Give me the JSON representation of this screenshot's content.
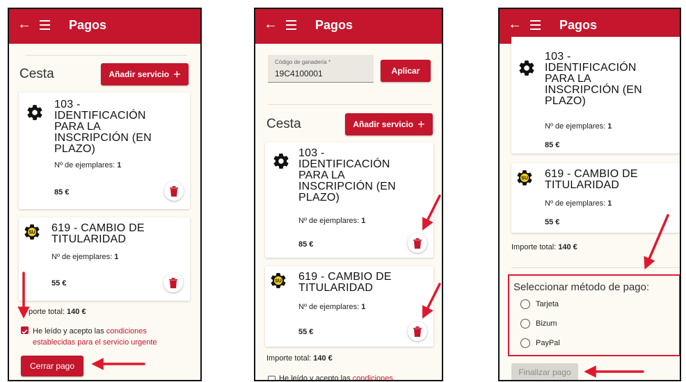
{
  "app": {
    "title": "Pagos"
  },
  "cart": {
    "heading": "Cesta",
    "add_service_label": "Añadir servicio",
    "items": [
      {
        "title_lines": [
          "103 -",
          "IDENTIFICACIÓN",
          "PARA LA",
          "INSCRIPCIÓN (EN",
          "PLAZO)"
        ],
        "qty_label": "Nº de ejemplares:",
        "qty": "1",
        "price": "85 €",
        "icon": "gear-icon"
      },
      {
        "title_lines": [
          "619 - CAMBIO DE",
          "TITULARIDAD"
        ],
        "qty_label": "Nº de ejemplares:",
        "qty": "1",
        "price": "55 €",
        "icon": "urgent-gear-icon",
        "badge": "SU"
      }
    ],
    "total_label": "Importe total:",
    "total_value": "140 €"
  },
  "screen1": {
    "total_partial_label": "porte total:",
    "terms_prefix": "He leído y acepto las",
    "terms_link_line1": "condiciones",
    "terms_link_line2": "establecidas para el servicio urgente",
    "terms_checked": true,
    "close_button": "Cerrar pago"
  },
  "screen2": {
    "code_label": "Código de ganadería *",
    "code_value": "19C4100001",
    "apply_button": "Aplicar",
    "terms_prefix": "He leído y acepto las",
    "terms_link": "condiciones",
    "terms_checked": false
  },
  "screen3": {
    "payment_title": "Seleccionar método de pago:",
    "methods": [
      "Tarjeta",
      "Bizum",
      "PayPal"
    ],
    "finish_button": "Finalizar pago"
  },
  "colors": {
    "brand": "#c4162c",
    "background": "#fdfaf3",
    "arrow": "#e0182e"
  }
}
